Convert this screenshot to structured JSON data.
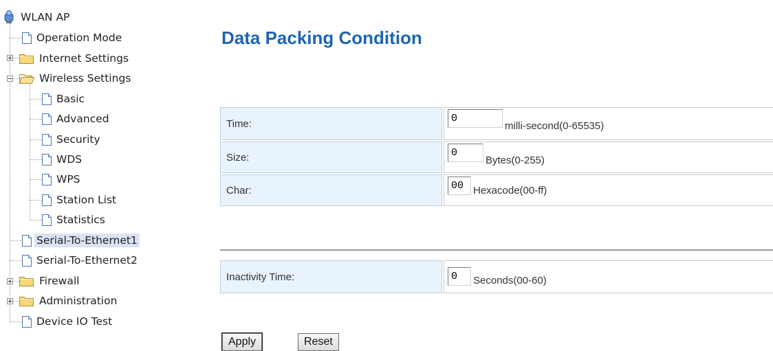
{
  "tree": {
    "root": "WLAN AP",
    "items": [
      {
        "label": "Operation Mode",
        "type": "doc"
      },
      {
        "label": "Internet Settings",
        "type": "folder",
        "collapsed": true
      },
      {
        "label": "Wireless Settings",
        "type": "folder-open",
        "collapsed": false,
        "children": [
          "Basic",
          "Advanced",
          "Security",
          "WDS",
          "WPS",
          "Station List",
          "Statistics"
        ]
      },
      {
        "label": "Serial-To-Ethernet1",
        "type": "doc",
        "selected": true
      },
      {
        "label": "Serial-To-Ethernet2",
        "type": "doc"
      },
      {
        "label": "Firewall",
        "type": "folder",
        "collapsed": true
      },
      {
        "label": "Administration",
        "type": "folder",
        "collapsed": true
      },
      {
        "label": "Device IO Test",
        "type": "doc"
      }
    ]
  },
  "page": {
    "title": "Data Packing Condition",
    "rows": [
      {
        "label": "Time:",
        "value": "0",
        "unit": "milli-second(0-65535)"
      },
      {
        "label": "Size:",
        "value": "0",
        "unit": "Bytes(0-255)"
      },
      {
        "label": "Char:",
        "value": "00",
        "unit": "Hexacode(00-ff)"
      }
    ],
    "inactivity": {
      "label": "Inactivity Time:",
      "value": "0",
      "unit": "Seconds(00-60)"
    },
    "buttons": {
      "apply": "Apply",
      "reset": "Reset"
    }
  },
  "colors": {
    "title": "#1d64b4",
    "label_bg": "#e8f3fd",
    "selected_bg": "#d9e3f3"
  }
}
